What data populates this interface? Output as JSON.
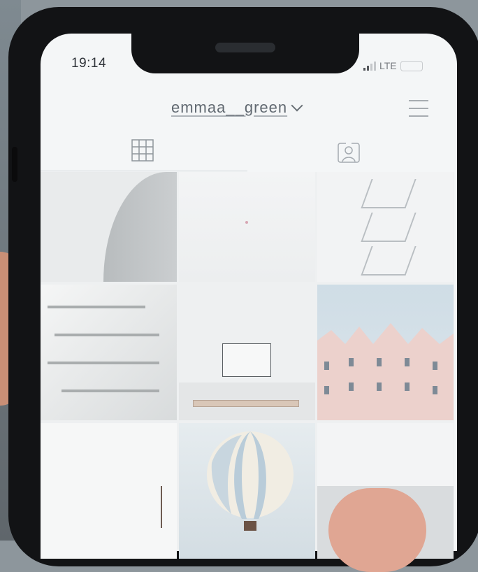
{
  "status_bar": {
    "time": "19:14",
    "network": "LTE",
    "signal_icon": "signal-bars-icon",
    "battery_icon": "battery-icon"
  },
  "profile": {
    "username": "emmaa__green",
    "dropdown_icon": "chevron-down-icon",
    "menu_icon": "hamburger-menu-icon"
  },
  "tabs": [
    {
      "name": "grid",
      "icon": "grid-icon",
      "active": true
    },
    {
      "name": "tagged",
      "icon": "tagged-person-icon",
      "active": false
    }
  ],
  "photos": [
    {
      "id": "photo-1",
      "subject": "white wall curve"
    },
    {
      "id": "photo-2",
      "subject": "white abstract"
    },
    {
      "id": "photo-3",
      "subject": "white stairs"
    },
    {
      "id": "photo-4",
      "subject": "library atrium"
    },
    {
      "id": "photo-5",
      "subject": "gallery frame"
    },
    {
      "id": "photo-6",
      "subject": "pink houses"
    },
    {
      "id": "photo-7",
      "subject": "white room"
    },
    {
      "id": "photo-8",
      "subject": "hot air balloon"
    },
    {
      "id": "photo-9",
      "subject": "arched hall"
    }
  ],
  "colors": {
    "screen_bg": "#f4f6f7",
    "phone_frame": "#121315",
    "text": "#616971"
  }
}
